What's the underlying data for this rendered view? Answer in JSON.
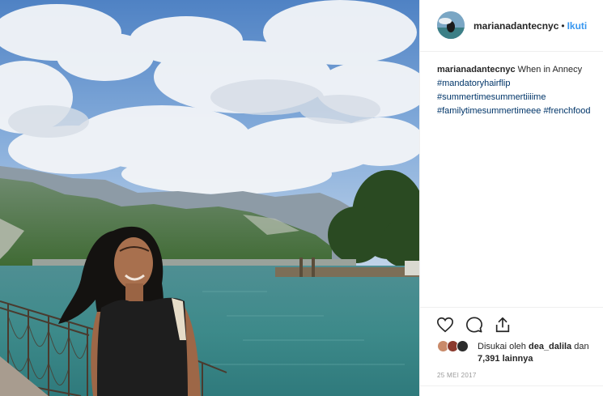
{
  "post": {
    "username": "marianadantecnyc",
    "separator": "•",
    "follow_label": "Ikuti",
    "caption_text": "When in Annecy",
    "hashtags": [
      "#mandatoryhairflip",
      "#summertimesummertiiiime",
      "#familytimesummertimeee",
      "#frenchfood"
    ],
    "liked_prefix": "Disukai oleh",
    "liked_user": "dea_dalila",
    "liked_conjunction": "dan",
    "likes_others": "7,391 lainnya",
    "date": "25 MEI 2017"
  },
  "icons": {
    "like": "heart-icon",
    "comment": "comment-icon",
    "share": "share-icon"
  },
  "colors": {
    "link_blue": "#3897f0",
    "hashtag_blue": "#003569",
    "divider": "#efefef",
    "muted": "#999999"
  }
}
